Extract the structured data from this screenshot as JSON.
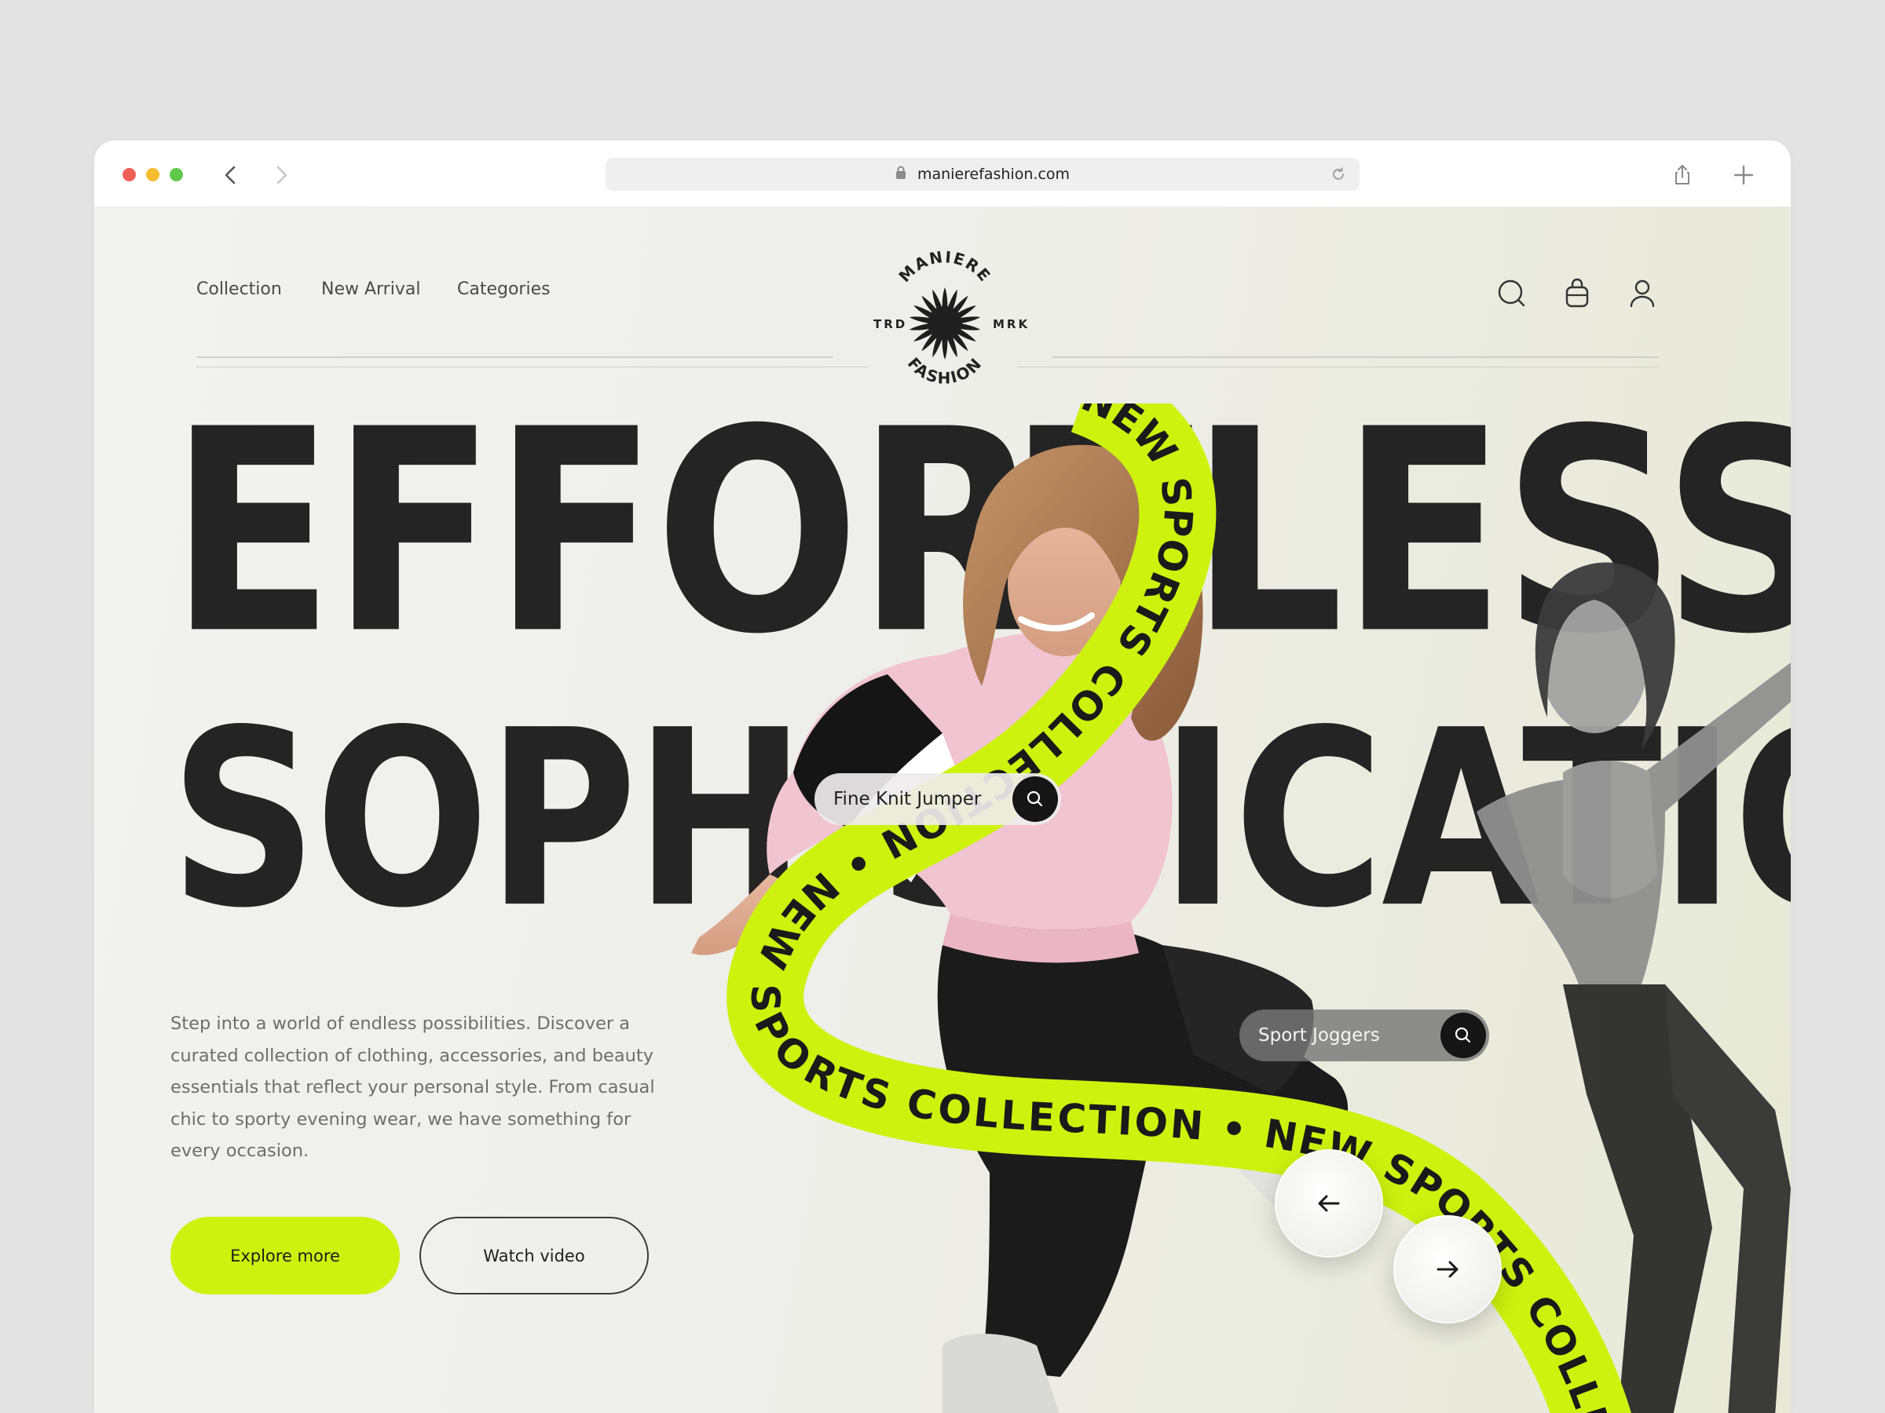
{
  "browser": {
    "url": "manierefashion.com",
    "traffic_lights": [
      "#ee5f57",
      "#f5bd2f",
      "#5fc84a"
    ]
  },
  "nav": {
    "links": [
      "Collection",
      "New Arrival",
      "Categories"
    ],
    "icons": [
      "search-icon",
      "bag-icon",
      "user-icon"
    ]
  },
  "logo": {
    "top": "MANIERE",
    "bottom": "FASHION",
    "left": "TRD",
    "right": "MRK"
  },
  "hero": {
    "line1": "EFFORTLESS",
    "line2": "SOPHISTICATION",
    "description": "Step into a world of endless possibilities. Discover a curated collection of clothing, accessories, and beauty essentials that reflect your personal style. From casual chic to sporty evening wear, we have something for every occasion.",
    "primary_button": "Explore more",
    "secondary_button": "Watch video"
  },
  "ribbon": {
    "text": "NEW SPORTS COLLECTION • NEW SPORTS COLLECTION • NEW SPORTS COLLECTION • ",
    "color": "#cdf20e"
  },
  "product_tags": [
    {
      "label": "Fine Knit Jumper"
    },
    {
      "label": "Sport Joggers"
    }
  ],
  "slider": {
    "prev_icon": "arrow-left-icon",
    "next_icon": "arrow-right-icon"
  },
  "colors": {
    "accent": "#cdf20e",
    "text_dark": "#242424"
  }
}
